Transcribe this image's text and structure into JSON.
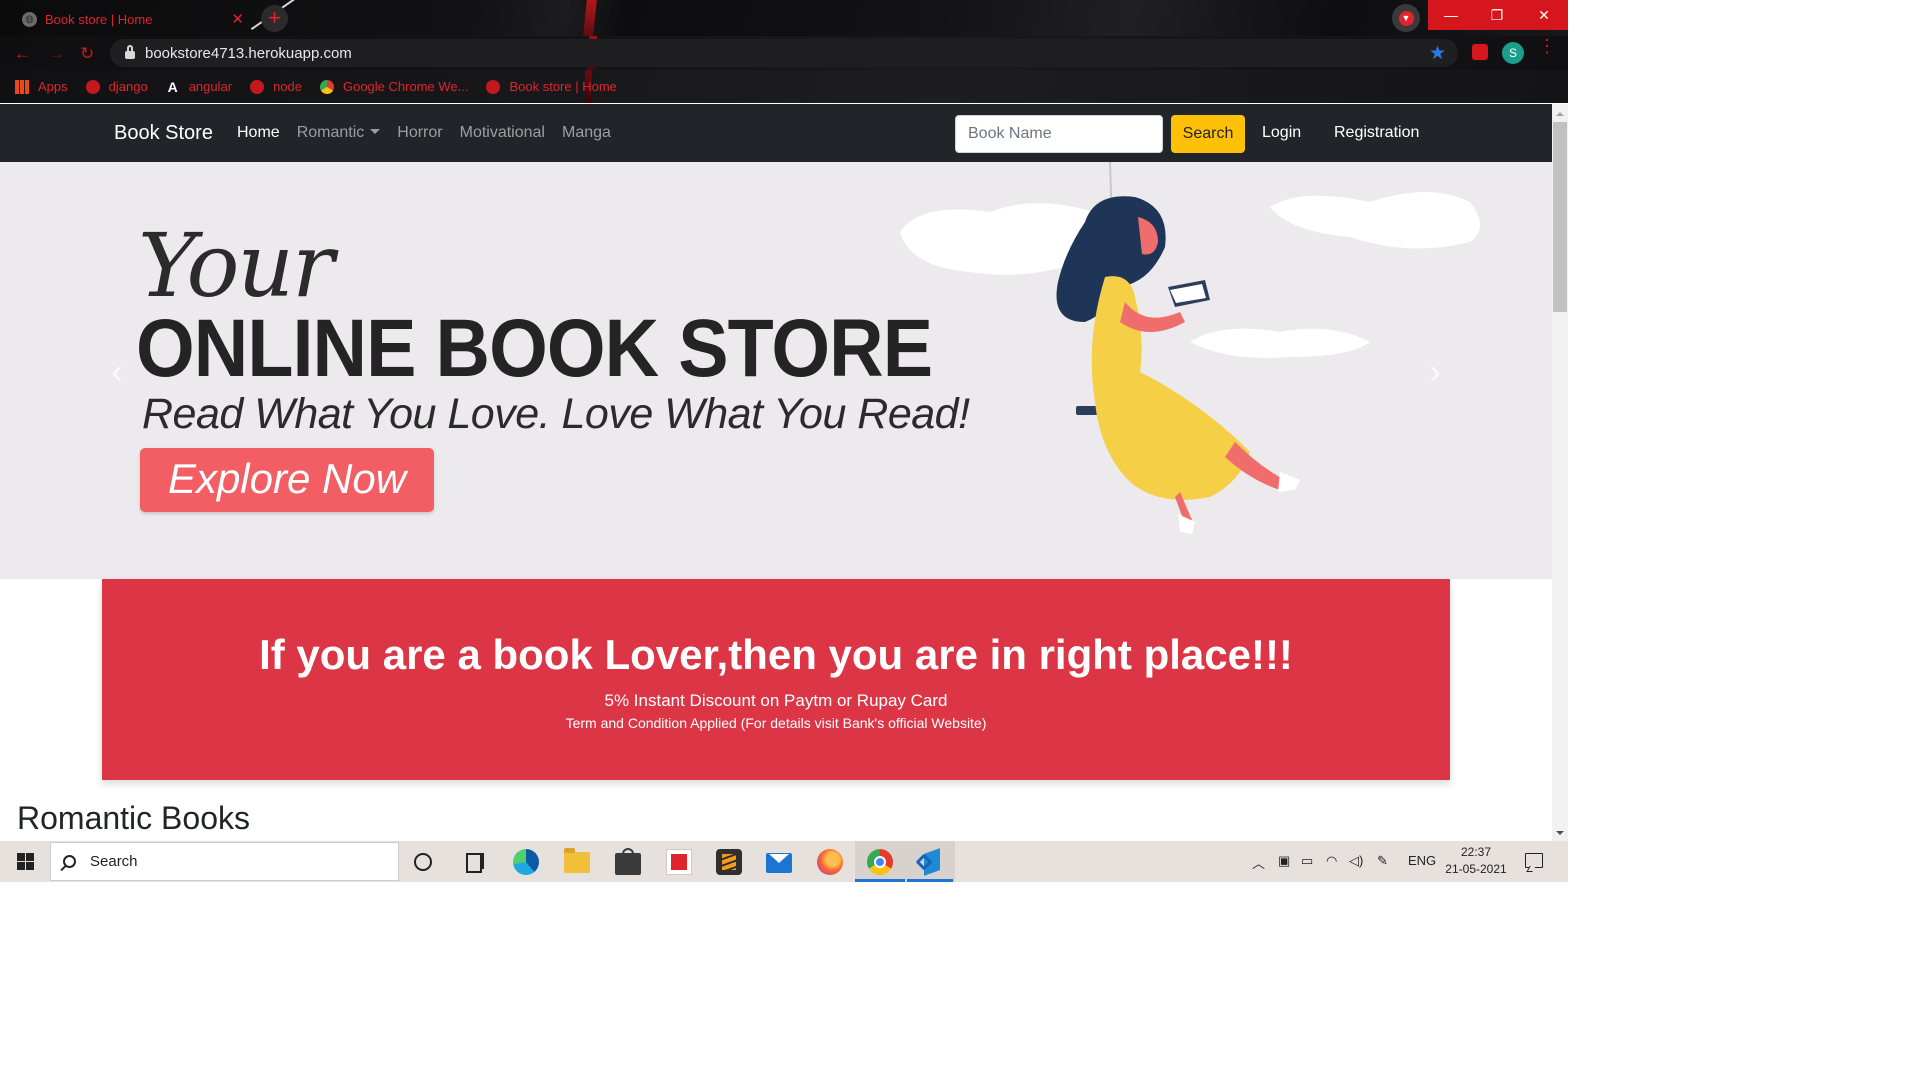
{
  "browser": {
    "tab": {
      "title": "Book store | Home",
      "close": "✕"
    },
    "new_tab": "+",
    "window_controls": {
      "minimize": "—",
      "maximize": "❐",
      "close": "✕"
    },
    "nav": {
      "back": "←",
      "forward": "→",
      "reload": "↻"
    },
    "address": {
      "url": "bookstore4713.herokuapp.com",
      "bookmark_star": "★"
    },
    "profile_initial": "S",
    "menu_icon": "⋮",
    "bookmarks": [
      {
        "label": "Apps",
        "icon": "apps-grid-icon"
      },
      {
        "label": "django",
        "icon": "globe-icon"
      },
      {
        "label": "angular",
        "icon": "angular-icon"
      },
      {
        "label": "node",
        "icon": "globe-icon"
      },
      {
        "label": "Google Chrome We...",
        "icon": "chrome-icon"
      },
      {
        "label": "Book store | Home",
        "icon": "globe-icon"
      }
    ]
  },
  "site": {
    "brand": "Book Store",
    "nav": {
      "home": "Home",
      "romantic": "Romantic",
      "horror": "Horror",
      "motivational": "Motivational",
      "manga": "Manga"
    },
    "search": {
      "placeholder": "Book Name",
      "button": "Search"
    },
    "login": "Login",
    "registration": "Registration",
    "hero": {
      "your": "Your",
      "headline": "ONLINE BOOK STORE",
      "tagline": "Read What You Love. Love What You Read!",
      "cta": "Explore Now",
      "prev": "‹",
      "next": "›"
    },
    "banner": {
      "headline": "If you are a book Lover,then you are in right place!!!",
      "discount": "5% Instant Discount on Paytm or Rupay Card",
      "terms": "Term and Condition Applied (For details visit Bank's official Website)"
    },
    "section_title": "Romantic Books"
  },
  "taskbar": {
    "search_text": "Search",
    "tray_language": "ENG",
    "time": "22:37",
    "date": "21-05-2021",
    "pinned": [
      "cortana-icon",
      "task-view-icon",
      "edge-icon",
      "file-explorer-icon",
      "store-icon",
      "gift-icon",
      "sublime-text-icon",
      "mail-icon",
      "firefox-icon",
      "chrome-icon",
      "vscode-icon"
    ]
  },
  "colors": {
    "accent_red": "#dc3545",
    "navbar_bg": "#212529",
    "search_button": "#ffc107",
    "chrome_red": "#e0242b",
    "explore_button": "#f25e63"
  }
}
